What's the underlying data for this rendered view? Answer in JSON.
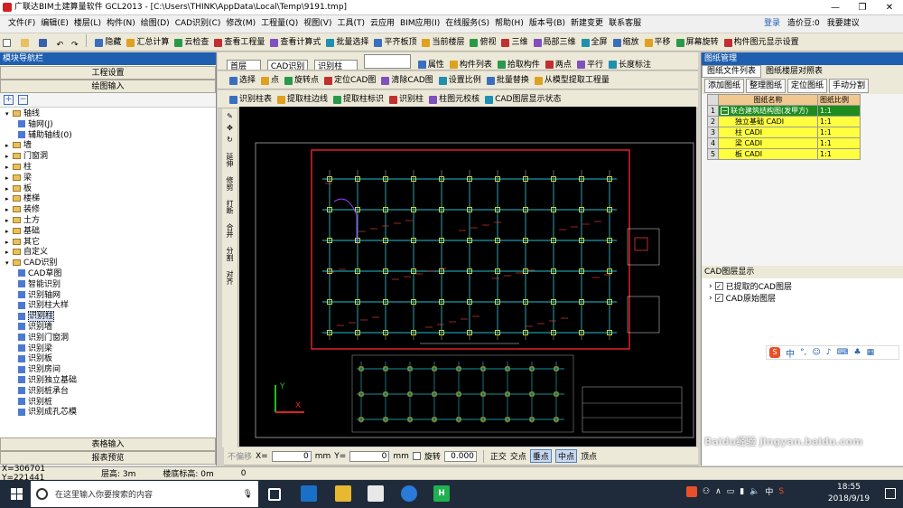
{
  "app": {
    "title": "广联达BIM土建算量软件 GCL2013 - [C:\\Users\\THINK\\AppData\\Local\\Temp\\9191.tmp]",
    "minimize_icon": "minimize",
    "maximize_icon": "restore",
    "close_icon": "close"
  },
  "menu": [
    "文件(F)",
    "编辑(E)",
    "楼层(L)",
    "构件(N)",
    "绘图(D)",
    "CAD识别(C)",
    "修改(M)",
    "工程量(Q)",
    "视图(V)",
    "工具(T)",
    "云应用",
    "BIM应用(I)",
    "在线服务(S)",
    "帮助(H)",
    "版本号(B)",
    "新建变更",
    "联系客服"
  ],
  "menu_right": {
    "login": "登录",
    "coins": "造价豆:0",
    "suggest": "我要建议"
  },
  "toolbar1": [
    "隐藏",
    "汇总计算",
    "云检查",
    "查看工程量",
    "查看计算式",
    "批量选择",
    "平齐板顶",
    "当前楼层",
    "俯视",
    "三维",
    "局部三维",
    "全屏",
    "缩放",
    "平移",
    "屏幕旋转",
    "构件图元显示设置"
  ],
  "toolbar2": {
    "floor": "首层",
    "cad": "CAD识别",
    "sub": "识别柱",
    "items": [
      "属性",
      "构件列表",
      "拾取构件",
      "两点",
      "平行",
      "长度标注"
    ]
  },
  "toolbar3": [
    "选择",
    "点",
    "旋转点",
    "定位CAD图",
    "清除CAD图",
    "设置比例",
    "批量替换",
    "从模型提取工程量"
  ],
  "toolbar4": [
    "识别柱表",
    "提取柱边线",
    "提取柱标识",
    "识别柱",
    "柱图元校核",
    "CAD图层显示状态"
  ],
  "nav": {
    "header": "模块导航栏",
    "project_settings": "工程设置",
    "drawing_input": "绘图输入",
    "table_input": "表格输入",
    "report_preview": "报表预览"
  },
  "tree": [
    {
      "level": 0,
      "label": "轴线",
      "open": true
    },
    {
      "level": 1,
      "label": "轴网(J)",
      "leaf": true
    },
    {
      "level": 1,
      "label": "辅助轴线(0)",
      "leaf": true
    },
    {
      "level": 0,
      "label": "墙"
    },
    {
      "level": 0,
      "label": "门窗洞"
    },
    {
      "level": 0,
      "label": "柱"
    },
    {
      "level": 0,
      "label": "梁"
    },
    {
      "level": 0,
      "label": "板"
    },
    {
      "level": 0,
      "label": "楼梯"
    },
    {
      "level": 0,
      "label": "装修"
    },
    {
      "level": 0,
      "label": "土方"
    },
    {
      "level": 0,
      "label": "基础"
    },
    {
      "level": 0,
      "label": "其它"
    },
    {
      "level": 0,
      "label": "自定义"
    },
    {
      "level": 0,
      "label": "CAD识别",
      "open": true
    },
    {
      "level": 1,
      "label": "CAD草图",
      "leaf": true
    },
    {
      "level": 1,
      "label": "智能识别",
      "leaf": true
    },
    {
      "level": 1,
      "label": "识别轴网",
      "leaf": true
    },
    {
      "level": 1,
      "label": "识别柱大样",
      "leaf": true
    },
    {
      "level": 1,
      "label": "识别柱",
      "leaf": true,
      "selected": true
    },
    {
      "level": 1,
      "label": "识别墙",
      "leaf": true
    },
    {
      "level": 1,
      "label": "识别门窗洞",
      "leaf": true
    },
    {
      "level": 1,
      "label": "识别梁",
      "leaf": true
    },
    {
      "level": 1,
      "label": "识别板",
      "leaf": true
    },
    {
      "level": 1,
      "label": "识别房间",
      "leaf": true
    },
    {
      "level": 1,
      "label": "识别独立基础",
      "leaf": true
    },
    {
      "level": 1,
      "label": "识别桩承台",
      "leaf": true
    },
    {
      "level": 1,
      "label": "识别桩",
      "leaf": true
    },
    {
      "level": 1,
      "label": "识别成孔芯模",
      "leaf": true
    }
  ],
  "vtools": [
    "延伸",
    "修剪",
    "打断",
    "合并",
    "分割",
    "对齐"
  ],
  "drawing_mgr": {
    "header": "图纸管理",
    "tab1": "图纸文件列表",
    "tab2": "图纸楼层对照表",
    "btn_add": "添加图纸",
    "btn_arrange": "整理图纸",
    "btn_locate": "定位图纸",
    "btn_split": "手动分割",
    "col_name": "图纸名称",
    "col_scale": "图纸比例",
    "rows": [
      {
        "no": "1",
        "name": "联合建筑结构图(发甲方)",
        "scale": "1:1",
        "top": true
      },
      {
        "no": "2",
        "name": "独立基础 CADI",
        "scale": "1:1"
      },
      {
        "no": "3",
        "name": "柱 CADI",
        "scale": "1:1"
      },
      {
        "no": "4",
        "name": "梁 CADI",
        "scale": "1:1"
      },
      {
        "no": "5",
        "name": "板 CADI",
        "scale": "1:1"
      }
    ]
  },
  "cad_layers": {
    "header": "CAD图层显示",
    "items": [
      "已提取的CAD图层",
      "CAD原始图层"
    ]
  },
  "ime": {
    "label": "中"
  },
  "bottombar": {
    "mode": "不偏移",
    "x_label": "X=",
    "x_val": "0",
    "y_label": "Y=",
    "y_val": "0",
    "unit": "mm",
    "rotate": "旋转",
    "rot_val": "0.000",
    "ortho": "正交",
    "intersect": "交点",
    "perp": "垂点",
    "mid": "中点",
    "vertex": "顶点"
  },
  "status": {
    "coords": "X=306701  Y=221441",
    "floor_height": "层高: 3m",
    "bottom_elev": "楼底标高: 0m",
    "zero": "0"
  },
  "taskbar": {
    "search": "在这里输入你要搜索的内容",
    "time": "18:55",
    "date": "2018/9/19"
  },
  "watermark": "Baidu经验 jingyan.baidu.com",
  "colors": {
    "header_blue": "#1f5fb0",
    "cad_red": "#e0202a",
    "grid_yellow": "#ffff40",
    "selected_green": "#1e8c1e"
  }
}
